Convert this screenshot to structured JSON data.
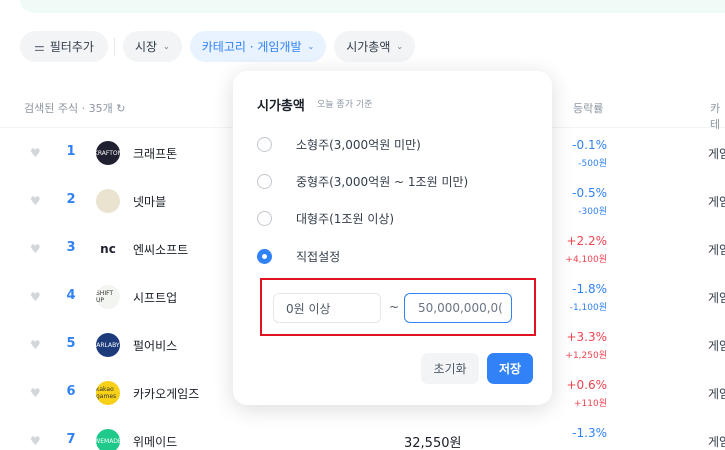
{
  "filters": {
    "add_label": "필터추가",
    "market_label": "시장",
    "category_label": "카테고리 · 게임개발",
    "marketcap_label": "시가총액"
  },
  "list": {
    "count_text": "검색된 주식 · 35개",
    "col_change": "등락률",
    "col_category": "카테"
  },
  "stocks": [
    {
      "rank": "1",
      "name": "크래프톤",
      "logo_text": "KRAFTON",
      "logo_color": "#1f2130",
      "price": "",
      "rate": "-0.1%",
      "diff": "-500원",
      "dir": "down",
      "category": "게임"
    },
    {
      "rank": "2",
      "name": "넷마블",
      "logo_text": "",
      "logo_color": "#e9e3d0",
      "price": "",
      "rate": "-0.5%",
      "diff": "-300원",
      "dir": "down",
      "category": "게임"
    },
    {
      "rank": "3",
      "name": "엔씨소프트",
      "logo_text": "nc",
      "logo_color": "#ffffff",
      "price": "",
      "rate": "+2.2%",
      "diff": "+4,100원",
      "dir": "up",
      "category": "게임"
    },
    {
      "rank": "4",
      "name": "시프트업",
      "logo_text": "SHIFT UP",
      "logo_color": "#f3f5f0",
      "price": "",
      "rate": "-1.8%",
      "diff": "-1,100원",
      "dir": "down",
      "category": "게임"
    },
    {
      "rank": "5",
      "name": "펄어비스",
      "logo_text": "PEARLABYSS",
      "logo_color": "#1d3b7a",
      "price": "",
      "rate": "+3.3%",
      "diff": "+1,250원",
      "dir": "up",
      "category": "게임"
    },
    {
      "rank": "6",
      "name": "카카오게임즈",
      "logo_text": "kakao games",
      "logo_color": "#f7d117",
      "price": "",
      "rate": "+0.6%",
      "diff": "+110원",
      "dir": "up",
      "category": "게임"
    },
    {
      "rank": "7",
      "name": "위메이드",
      "logo_text": "WEMADE",
      "logo_color": "#1ec98a",
      "price": "32,550원",
      "rate": "-1.3%",
      "diff": "",
      "dir": "down",
      "category": "게임"
    }
  ],
  "popup": {
    "title": "시가총액",
    "subtitle": "오늘 종가 기준",
    "options": [
      {
        "label": "소형주(3,000억원 미만)",
        "selected": false
      },
      {
        "label": "중형주(3,000억원 ~ 1조원 미만)",
        "selected": false
      },
      {
        "label": "대형주(1조원 이상)",
        "selected": false
      },
      {
        "label": "직접설정",
        "selected": true
      }
    ],
    "min_placeholder": "0원 이상",
    "range_separator": "~",
    "max_value": "50,000,000,0(",
    "reset_label": "초기화",
    "save_label": "저장"
  },
  "colors": {
    "accent": "#3182f6",
    "up": "#f04452",
    "down": "#3182f6",
    "highlight_box": "#e0141e"
  }
}
